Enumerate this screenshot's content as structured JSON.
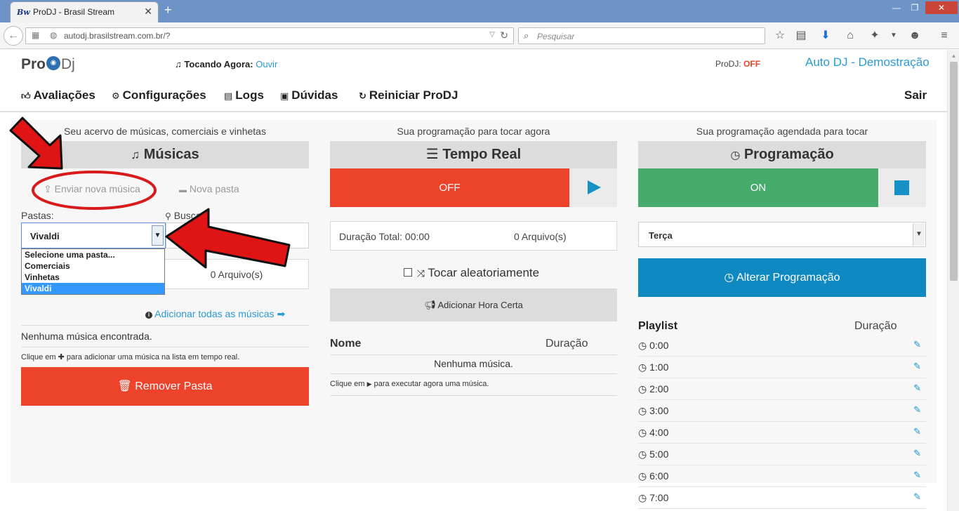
{
  "browser": {
    "tab_favicon": "Bw",
    "tab_title": "ProDJ - Brasil Stream",
    "tab_close": "✕",
    "new_tab": "+",
    "min_btn": "—",
    "max_btn": "❐",
    "close_btn": "✕",
    "url": "autodj.brasilstream.com.br/?",
    "search_placeholder": "Pesquisar"
  },
  "header": {
    "logo_pro": "Pro",
    "logo_dj": "Dj",
    "now_playing_label": "Tocando Agora:",
    "now_playing_link": "Ouvir",
    "prodj_label": "ProDJ:",
    "prodj_status": "OFF",
    "account_name": "Auto DJ - Demostração"
  },
  "menu": {
    "items": [
      {
        "label": "Avaliações",
        "icon": "thumbs-up-icon"
      },
      {
        "label": "Configurações",
        "icon": "gear-icon"
      },
      {
        "label": "Logs",
        "icon": "book-icon"
      },
      {
        "label": "Dúvidas",
        "icon": "briefcase-icon"
      },
      {
        "label": "Reiniciar ProDJ",
        "icon": "refresh-icon"
      }
    ],
    "logout": "Sair"
  },
  "musicas": {
    "caption": "Seu acervo de músicas, comerciais e vinhetas",
    "title": "Músicas",
    "upload_label": "Enviar nova música",
    "new_folder_label": "Nova pasta",
    "folders_label": "Pastas:",
    "search_label": "Buscar:",
    "selected_folder": "Vivaldi",
    "folder_options": [
      "Selecione uma pasta...",
      "Comerciais",
      "Vinhetas",
      "Vivaldi"
    ],
    "file_count": "0 Arquivo(s)",
    "add_all_label": "Adicionar todas as músicas",
    "empty_message": "Nenhuma música encontrada.",
    "hint_before": "Clique em",
    "hint_after": "para adicionar uma música na lista em tempo real.",
    "remove_folder_label": "Remover Pasta"
  },
  "tempo_real": {
    "caption": "Sua programação para tocar agora",
    "title": "Tempo Real",
    "status": "OFF",
    "total_duration": "Duração Total: 00:00",
    "file_count": "0 Arquivo(s)",
    "shuffle_label": "Tocar aleatoriamente",
    "hora_certa_label": "Adicionar Hora Certa",
    "col_name": "Nome",
    "col_duration": "Duração",
    "empty_message": "Nenhuma música.",
    "hint_before": "Clique em",
    "hint_after": "para executar agora uma música."
  },
  "programacao": {
    "caption": "Sua programação agendada para tocar",
    "title": "Programação",
    "status": "ON",
    "selected_day": "Terça",
    "change_label": "Alterar Programação",
    "playlist_label": "Playlist",
    "duration_label": "Duração",
    "times": [
      "0:00",
      "1:00",
      "2:00",
      "3:00",
      "4:00",
      "5:00",
      "6:00",
      "7:00"
    ]
  },
  "colors": {
    "accent_blue": "#1591c6",
    "status_red": "#ec432a",
    "status_green": "#47ab6c",
    "link_blue": "#2a9ad5",
    "annotation_red": "#d91a1a"
  }
}
